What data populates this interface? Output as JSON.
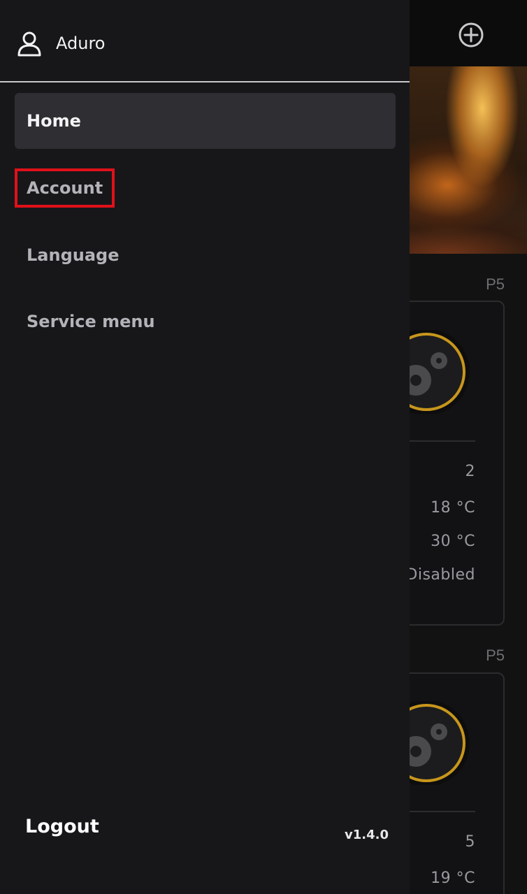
{
  "drawer": {
    "username": "Aduro",
    "menu_items": [
      {
        "label": "Home"
      },
      {
        "label": "Account"
      },
      {
        "label": "Language"
      },
      {
        "label": "Service menu"
      }
    ],
    "logout_label": "Logout",
    "version": "v1.4.0"
  },
  "background": {
    "stoves": [
      {
        "label": "P5",
        "values": [
          "2",
          "18 °C",
          "30 °C",
          "Disabled"
        ]
      },
      {
        "label": "P5",
        "values": [
          "5",
          "19 °C"
        ]
      }
    ]
  },
  "colors": {
    "drawer_bg": "#17171a",
    "active_item_bg": "#2f2f33",
    "highlight": "#e0101a",
    "knob_ring": "#c8961c"
  },
  "icons": {
    "user": "user-icon",
    "add": "add-circle-icon",
    "stove_status": "gears-icon"
  }
}
